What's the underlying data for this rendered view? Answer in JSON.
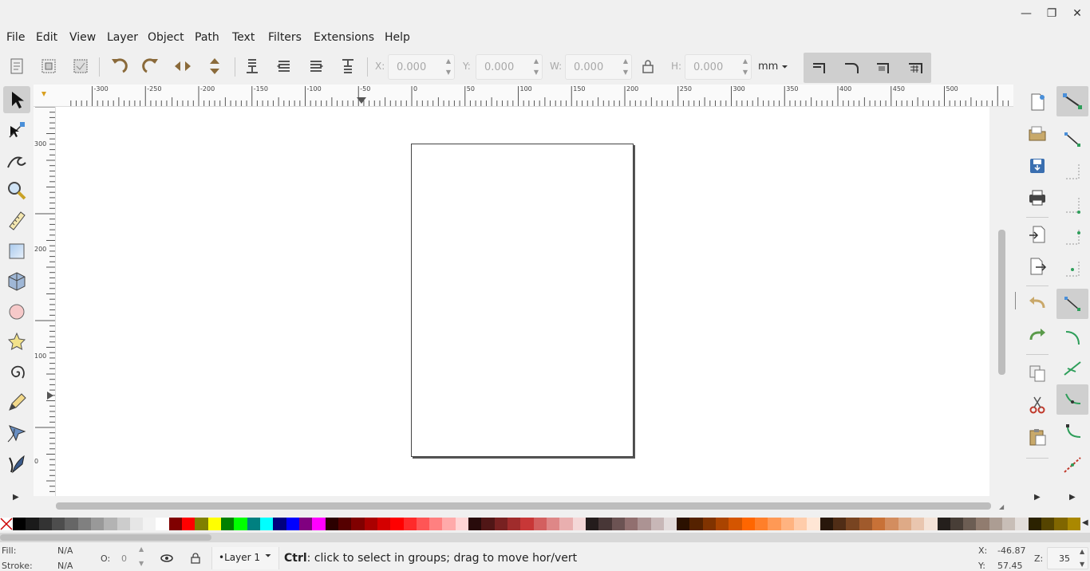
{
  "window": {
    "minimize_glyph": "—",
    "maximize_glyph": "❐",
    "close_glyph": "✕"
  },
  "menu": [
    "File",
    "Edit",
    "View",
    "Layer",
    "Object",
    "Path",
    "Text",
    "Filters",
    "Extensions",
    "Help"
  ],
  "toolbar": {
    "x_label": "X:",
    "x_value": "0.000",
    "y_label": "Y:",
    "y_value": "0.000",
    "w_label": "W:",
    "w_value": "0.000",
    "h_label": "H:",
    "h_value": "0.000",
    "unit": "mm",
    "unit_arrow": "⏷"
  },
  "ruler": {
    "labels": [
      "-300",
      "-250",
      "-200",
      "-150",
      "-100",
      "-50",
      "0",
      "50",
      "100",
      "150",
      "200",
      "250",
      "300",
      "350",
      "400",
      "450",
      "500"
    ],
    "vertical_labels": [
      "300",
      "200",
      "100",
      "0"
    ]
  },
  "status": {
    "fill_label": "Fill:",
    "fill_value": "N/A",
    "stroke_label": "Stroke:",
    "stroke_value": "N/A",
    "opacity_label": "O:",
    "opacity_value": "0",
    "layer_name": "•Layer 1",
    "message_key": "Ctrl",
    "message_text": ": click to select in groups; drag to move hor/vert",
    "cursor_x_label": "X:",
    "cursor_x": "-46.87",
    "cursor_y_label": "Y:",
    "cursor_y": "57.45",
    "zoom_label": "Z:",
    "zoom_value": "35"
  },
  "palette": [
    "#000000",
    "#1a1a1a",
    "#333333",
    "#4d4d4d",
    "#666666",
    "#808080",
    "#999999",
    "#b3b3b3",
    "#cccccc",
    "#e6e6e6",
    "#f2f2f2",
    "#ffffff",
    "#800000",
    "#ff0000",
    "#808000",
    "#ffff00",
    "#008000",
    "#00ff00",
    "#008080",
    "#00ffff",
    "#000080",
    "#0000ff",
    "#800080",
    "#ff00ff",
    "#2b0000",
    "#550000",
    "#800000",
    "#aa0000",
    "#d40000",
    "#ff0000",
    "#ff2a2a",
    "#ff5555",
    "#ff8080",
    "#ffaaaa",
    "#ffd5d5",
    "#280b0b",
    "#501616",
    "#782121",
    "#a02c2c",
    "#c83737",
    "#d35f5f",
    "#de8787",
    "#e9afaf",
    "#f4d7d7",
    "#241c1c",
    "#483737",
    "#6c5353",
    "#916f6f",
    "#ac9393",
    "#c8b7b7",
    "#e3dbdb",
    "#2b1100",
    "#552200",
    "#803300",
    "#aa4400",
    "#d45500",
    "#ff6600",
    "#ff7f2a",
    "#ff9955",
    "#ffb380",
    "#ffccaa",
    "#ffe6d5",
    "#28170b",
    "#502d16",
    "#784421",
    "#a05a2c",
    "#c87137",
    "#d38d5f",
    "#deaa87",
    "#e9c6af",
    "#f4e3d7",
    "#241f1c",
    "#483e37",
    "#6c5d53",
    "#917c6f",
    "#ac9d93",
    "#c8beb7",
    "#e3dedb",
    "#2b2200",
    "#554400",
    "#806600",
    "#aa8800"
  ]
}
